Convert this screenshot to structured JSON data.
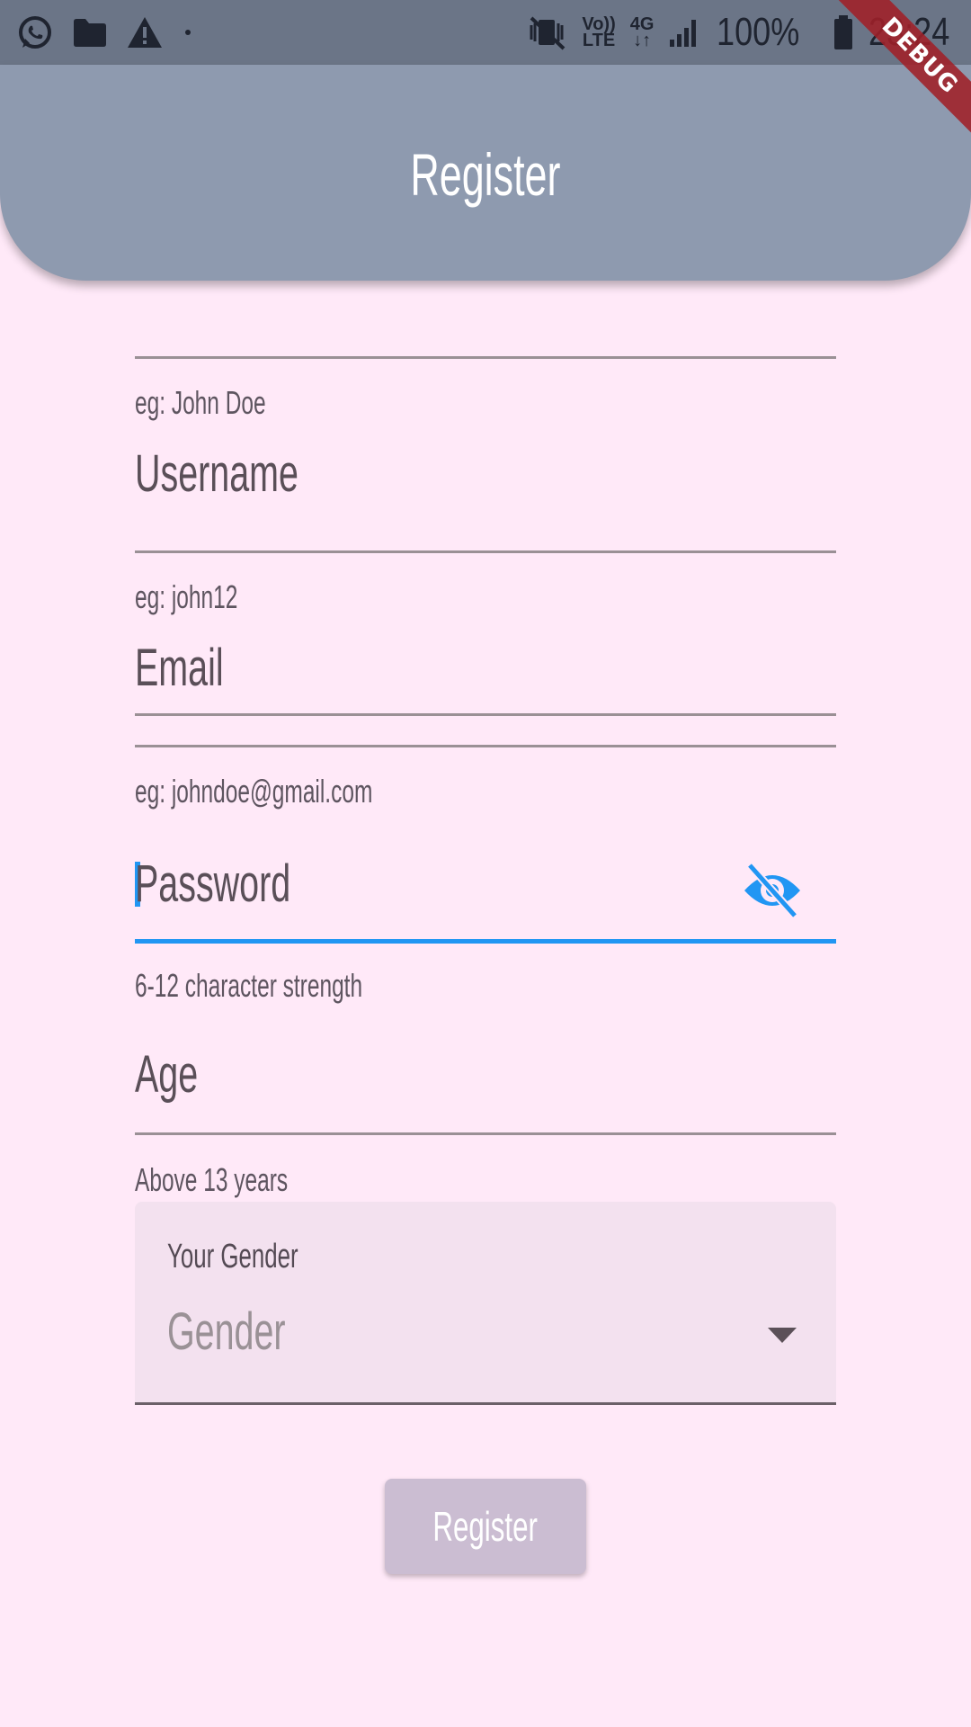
{
  "status_bar": {
    "icons_left": [
      "whatsapp-icon",
      "folder-icon",
      "warning-icon",
      "dot-icon"
    ],
    "icons_right": [
      "vibrate-mute-icon",
      "volte-icon",
      "network-4g-icon",
      "signal-icon",
      "battery-icon"
    ],
    "volte_label_top": "Vo))",
    "volte_label_bottom": "LTE",
    "network_label_top": "4G",
    "network_label_bottom": "↓↑",
    "battery_percent": "100%",
    "time": "23:24"
  },
  "debug_banner": {
    "label": "DEBUG"
  },
  "app_bar": {
    "title": "Register",
    "color": "#8e9aaf"
  },
  "form": {
    "name": {
      "helper": "eg: John Doe"
    },
    "username": {
      "label": "Username",
      "helper": "eg: john12"
    },
    "email": {
      "label": "Email",
      "helper": "eg: johndoe@gmail.com"
    },
    "password": {
      "label": "Password",
      "helper": "6-12 character strength",
      "toggle_icon": "visibility-off-icon",
      "focused": true,
      "accent_color": "#2196f3"
    },
    "age": {
      "label": "Age",
      "helper": "Above 13 years"
    },
    "gender": {
      "label": "Your Gender",
      "placeholder": "Gender",
      "icon": "arrow-drop-down-icon"
    },
    "submit_label": "Register"
  }
}
